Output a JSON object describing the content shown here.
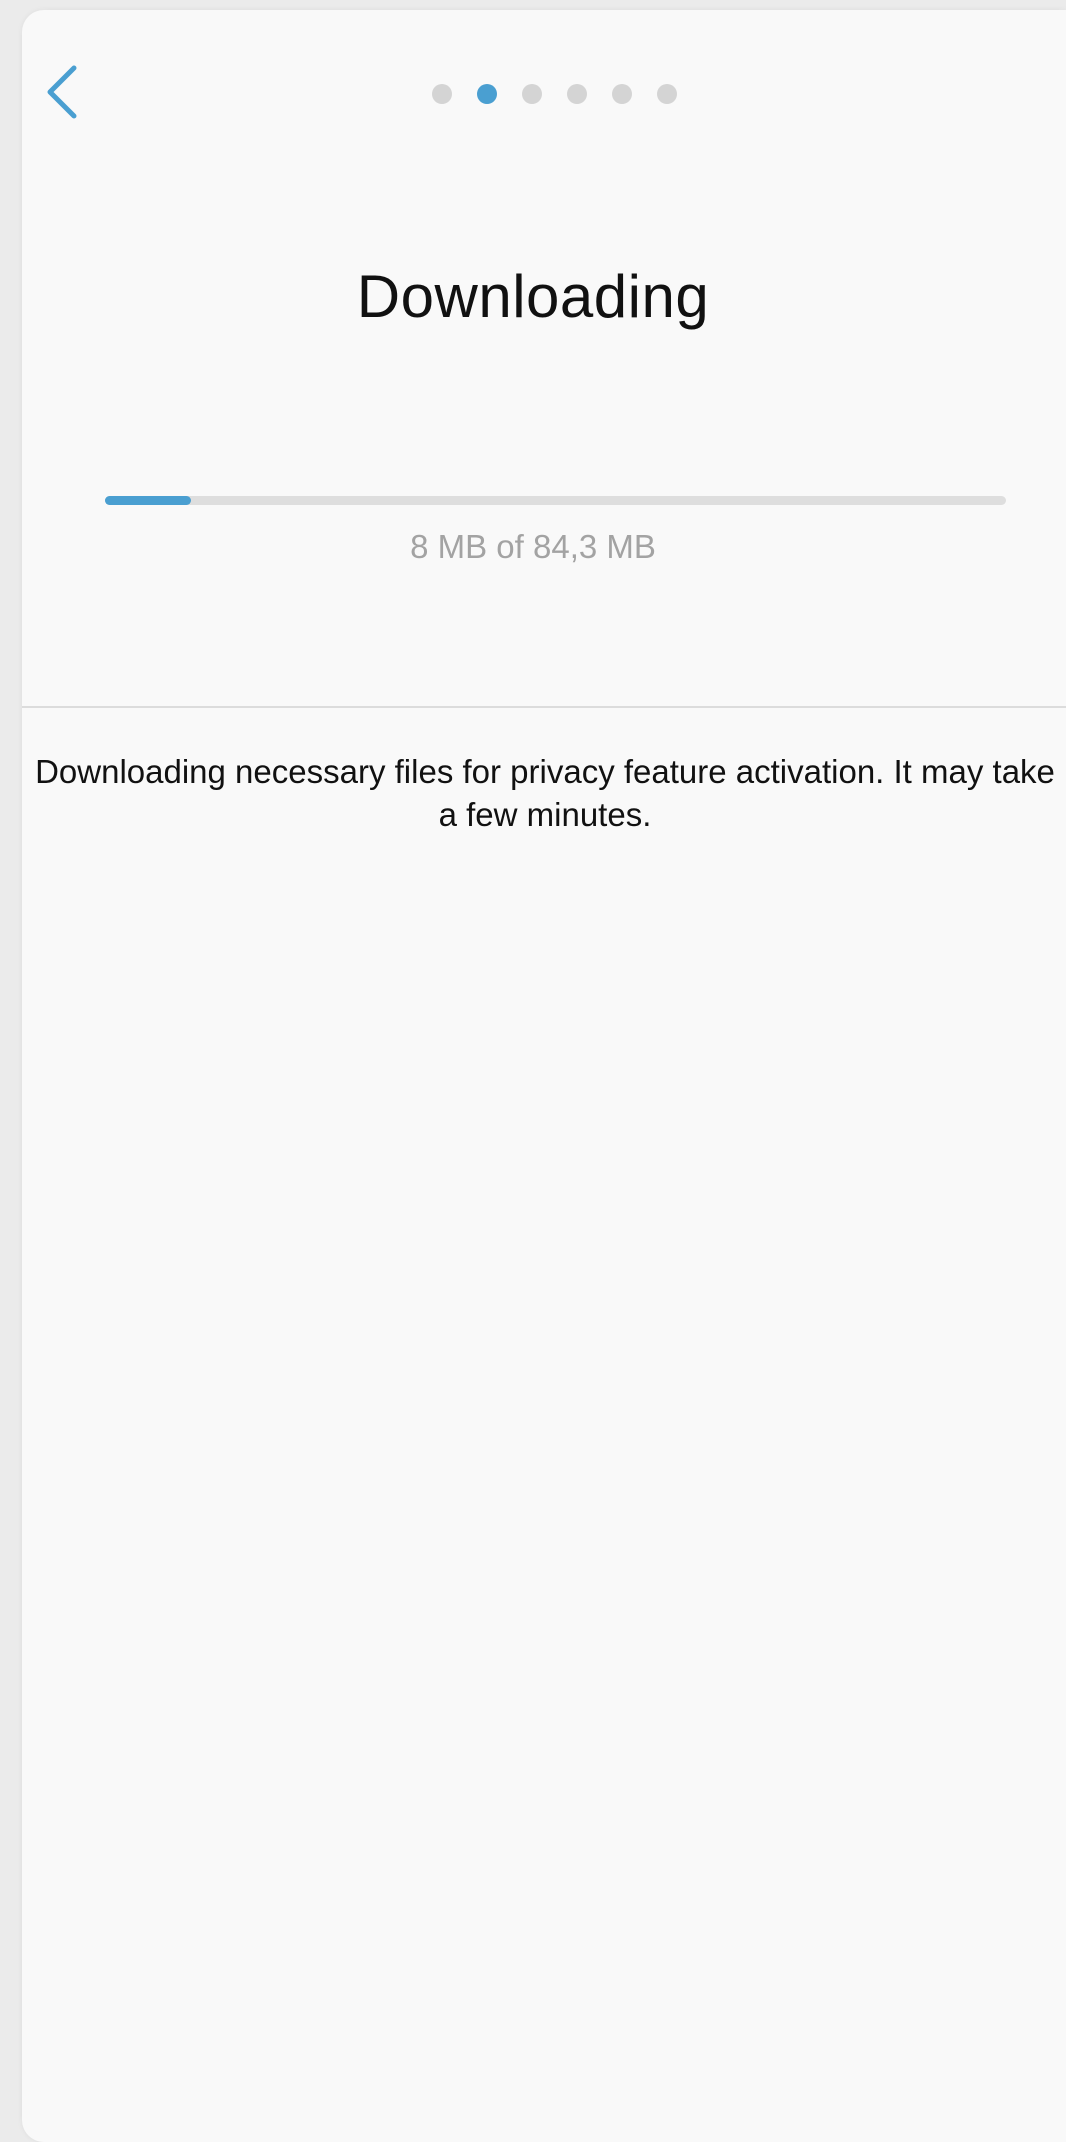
{
  "header": {
    "back_icon": "chevron-left-icon",
    "pager": {
      "total": 6,
      "active_index": 1
    }
  },
  "main": {
    "title": "Downloading",
    "progress": {
      "fraction": 0.095,
      "label": "8 MB of 84,3 MB"
    },
    "description": "Downloading necessary files for privacy feature activation. It may take a few minutes."
  },
  "colors": {
    "accent": "#4a9fd1",
    "track": "#dedede",
    "dot_inactive": "#d4d4d4",
    "background": "#f9f9f9",
    "text_primary": "#111111",
    "text_secondary": "#a3a3a3"
  }
}
